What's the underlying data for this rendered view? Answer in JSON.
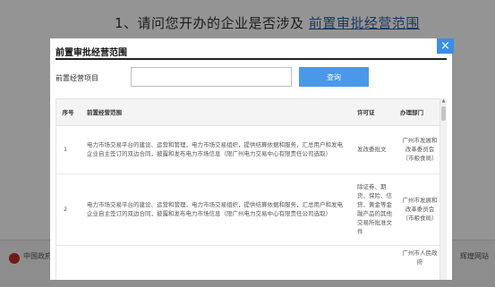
{
  "background": {
    "question_text": "1、请问您开办的企业是否涉及",
    "question_link": "前置审批经营范围",
    "footer_left": "中国政府网",
    "footer_right": "辉煌网站"
  },
  "modal": {
    "title": "前置审批经营范围",
    "close_label": "×",
    "search": {
      "label": "前置经营项目",
      "value": "",
      "placeholder": "",
      "button_label": "查询"
    },
    "table": {
      "headers": [
        "序号",
        "前置经营范围",
        "许可证",
        "办理部门"
      ],
      "rows": [
        {
          "seq": "1",
          "scope": "电力市场交易平台的建设、运营和管理，电力市场交易组织，提供结算依据和服务，汇总用户和发电企业自主签订的双边合同，披露和发布电力市场信息（限广州电力交易中心有限责任公司选取）",
          "license": "发改委批文",
          "dept": "广州市发展和改革委员会（市粮食局）"
        },
        {
          "seq": "2",
          "scope": "电力市场交易平台的建设、运营和管理，电力市场交易组织，提供结算依据和服务，汇总用户和发电企业自主签订的双边合同，披露和发布电力市场信息（限广州电力交易中心有限责任公司选取）",
          "license": "除证券、期货、保险、信贷、黄金等金融产品的其他交易所批准文件",
          "dept": "广州市发展和改革委员会（市粮食局）"
        },
        {
          "seq": "",
          "scope": "",
          "license": "",
          "dept": "广州市人民政府"
        }
      ]
    }
  },
  "colors": {
    "close_button": "#3a8ee6",
    "search_button": "#4a98e8",
    "link": "#2f5fa7"
  },
  "icons": {
    "close": "close-icon",
    "scroll_up": "chevron-up-icon"
  }
}
